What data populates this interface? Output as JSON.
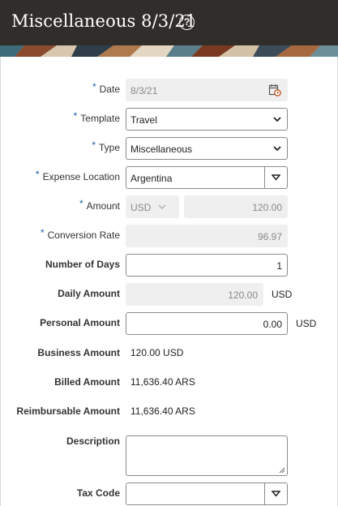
{
  "header": {
    "title": "Miscellaneous 8/3/21",
    "help_icon": "?"
  },
  "form": {
    "required_marker": "*",
    "date": {
      "label": "Date",
      "value": "8/3/21",
      "icon": "calendar-icon"
    },
    "template": {
      "label": "Template",
      "value": "Travel"
    },
    "type": {
      "label": "Type",
      "value": "Miscellaneous"
    },
    "expense_location": {
      "label": "Expense Location",
      "value": "Argentina"
    },
    "amount": {
      "label": "Amount",
      "currency": "USD",
      "value": "120.00"
    },
    "conversion_rate": {
      "label": "Conversion Rate",
      "value": "96.97"
    },
    "number_of_days": {
      "label": "Number of Days",
      "value": "1"
    },
    "daily_amount": {
      "label": "Daily Amount",
      "value": "120.00",
      "unit": "USD"
    },
    "personal_amount": {
      "label": "Personal Amount",
      "value": "0.00",
      "unit": "USD"
    },
    "business_amount": {
      "label": "Business Amount",
      "value": "120.00 USD"
    },
    "billed_amount": {
      "label": "Billed Amount",
      "value": "11,636.40 ARS"
    },
    "reimbursable_amount": {
      "label": "Reimbursable Amount",
      "value": "11,636.40 ARS"
    },
    "description": {
      "label": "Description",
      "value": ""
    },
    "tax_code": {
      "label": "Tax Code",
      "value": ""
    }
  },
  "colors": {
    "header_bg": "#312d2a",
    "required_marker": "#1a5fa8",
    "readonly_bg": "#efefef"
  }
}
